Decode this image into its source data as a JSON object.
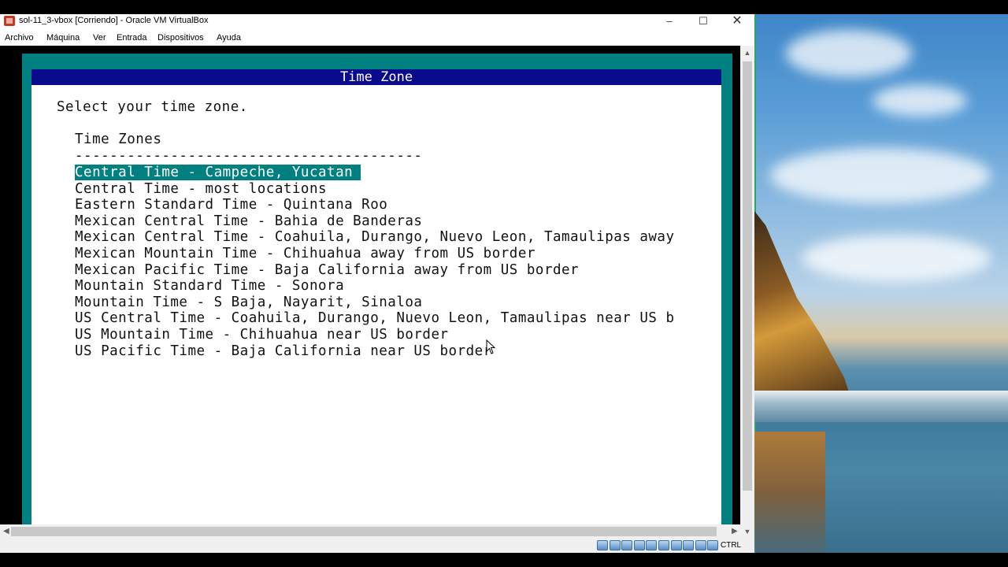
{
  "window": {
    "title": "sol-11_3-vbox [Corriendo] - Oracle VM VirtualBox",
    "controls": {
      "minimize": "–",
      "maximize": "☐",
      "close": "✕"
    }
  },
  "menubar": {
    "items": [
      "Archivo",
      "Máquina",
      "Ver",
      "Entrada",
      "Dispositivos",
      "Ayuda"
    ]
  },
  "installer": {
    "dialog_title": "Time Zone",
    "prompt": "Select your time zone.",
    "list_header": "Time Zones",
    "divider": "----------------------------------------",
    "selected_index": 0,
    "time_zones": [
      "Central Time - Campeche, Yucatan",
      "Central Time - most locations",
      "Eastern Standard Time - Quintana Roo",
      "Mexican Central Time - Bahia de Banderas",
      "Mexican Central Time - Coahuila, Durango, Nuevo Leon, Tamaulipas away",
      "Mexican Mountain Time - Chihuahua away from US border",
      "Mexican Pacific Time - Baja California away from US border",
      "Mountain Standard Time - Sonora",
      "Mountain Time - S Baja, Nayarit, Sinaloa",
      "US Central Time - Coahuila, Durango, Nuevo Leon, Tamaulipas near US b",
      "US Mountain Time - Chihuahua near US border",
      "US Pacific Time - Baja California near US border"
    ]
  },
  "scrollbars": {
    "up": "▲",
    "down": "▼",
    "left": "◀",
    "right": "▶"
  },
  "statusbar": {
    "icons": [
      "hard-disk-icon",
      "optical-drive-icon",
      "floppy-icon",
      "network-icon",
      "usb-icon",
      "shared-folder-icon",
      "display-icon",
      "video-capture-icon",
      "cpu-icon",
      "mouse-integration-icon"
    ],
    "host_key": "CTRL"
  },
  "colors": {
    "selection": "#008080",
    "dialog_header": "#0a0a8c",
    "frame": "#008080"
  }
}
